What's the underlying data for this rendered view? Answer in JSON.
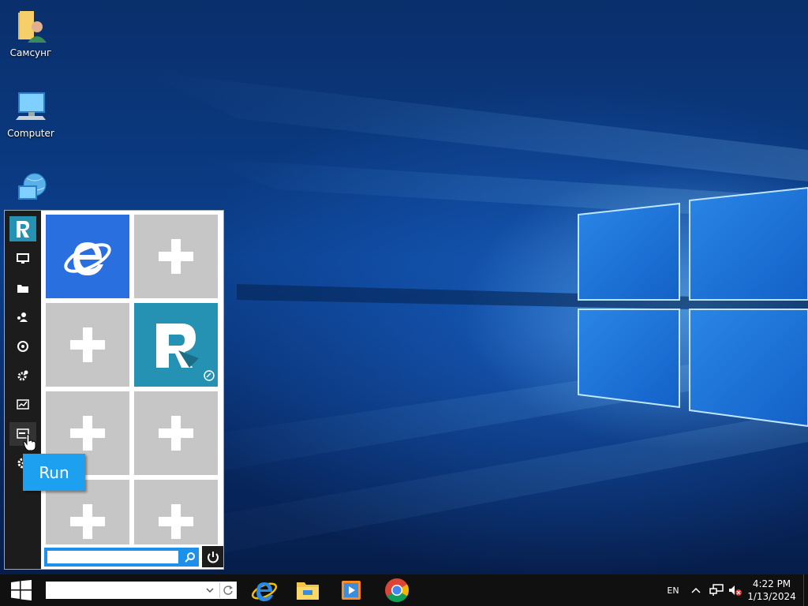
{
  "desktop": {
    "icons": [
      {
        "label": "Самсунг",
        "icon": "user-folder-icon"
      },
      {
        "label": "Computer",
        "icon": "computer-icon"
      },
      {
        "label": "",
        "icon": "network-icon"
      }
    ]
  },
  "start_menu": {
    "rail": [
      {
        "name": "app-logo",
        "icon": "remote-app-logo-icon"
      },
      {
        "name": "desktop",
        "icon": "monitor-icon"
      },
      {
        "name": "explorer",
        "icon": "folder-icon"
      },
      {
        "name": "users",
        "icon": "users-icon"
      },
      {
        "name": "network",
        "icon": "network-globe-icon"
      },
      {
        "name": "control-panel",
        "icon": "gears-icon"
      },
      {
        "name": "task-manager",
        "icon": "chart-icon"
      },
      {
        "name": "run",
        "icon": "run-icon"
      },
      {
        "name": "settings",
        "icon": "gear-icon"
      }
    ],
    "tiles": [
      {
        "type": "app",
        "icon": "internet-explorer-icon"
      },
      {
        "type": "add",
        "icon": "plus-icon"
      },
      {
        "type": "add",
        "icon": "plus-icon"
      },
      {
        "type": "app",
        "icon": "remote-app-logo-icon"
      },
      {
        "type": "add",
        "icon": "plus-icon"
      },
      {
        "type": "add",
        "icon": "plus-icon"
      },
      {
        "type": "add",
        "icon": "plus-icon"
      },
      {
        "type": "add",
        "icon": "plus-icon"
      }
    ],
    "search": {
      "value": "",
      "placeholder": ""
    },
    "tooltip": "Run"
  },
  "taskbar": {
    "search": {
      "value": "",
      "placeholder": ""
    },
    "apps": [
      "internet-explorer-icon",
      "file-explorer-icon",
      "media-player-icon",
      "chrome-icon"
    ],
    "language": "EN",
    "time": "4:22 PM",
    "date": "1/13/2024"
  },
  "colors": {
    "accent": "#1ea0f0",
    "taskbar": "#101010",
    "rail": "#1c1c1c",
    "tile_empty": "#c6c6c6"
  }
}
